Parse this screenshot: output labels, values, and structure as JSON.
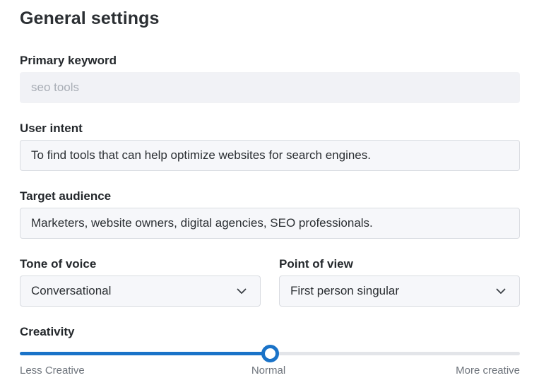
{
  "page": {
    "title": "General settings"
  },
  "fields": {
    "primary_keyword": {
      "label": "Primary keyword",
      "placeholder": "seo tools"
    },
    "user_intent": {
      "label": "User intent",
      "value": "To find tools that can help optimize websites for search engines."
    },
    "target_audience": {
      "label": "Target audience",
      "value": "Marketers, website owners, digital agencies, SEO professionals."
    },
    "tone_of_voice": {
      "label": "Tone of voice",
      "selected": "Conversational"
    },
    "point_of_view": {
      "label": "Point of view",
      "selected": "First person singular"
    }
  },
  "creativity": {
    "label": "Creativity",
    "min_label": "Less Creative",
    "mid_label": "Normal",
    "max_label": "More creative",
    "level": 0.5,
    "accent_color": "#1a73c8"
  },
  "icons": {
    "dropdown": "chevron-down-icon"
  }
}
